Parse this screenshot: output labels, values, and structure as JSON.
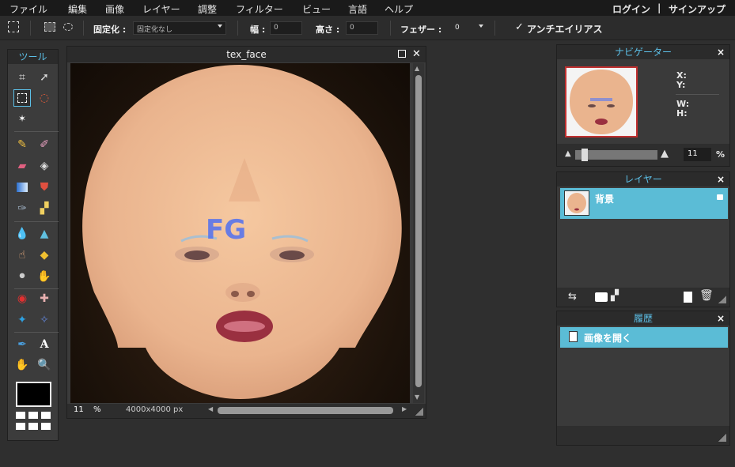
{
  "menu": [
    "ファイル",
    "編集",
    "画像",
    "レイヤー",
    "調整",
    "フィルター",
    "ビュー",
    "言語",
    "ヘルプ"
  ],
  "auth": {
    "login": "ログイン",
    "sep": "|",
    "signup": "サインアップ"
  },
  "options": {
    "fixed_label": "固定化 :",
    "fixed_value": "固定化なし",
    "width_label": "幅 :",
    "width_value": "0",
    "height_label": "高さ :",
    "height_value": "0",
    "feather_label": "フェザー :",
    "feather_value": "0",
    "antialias_label": "アンチエイリアス",
    "antialias_check": "✓"
  },
  "tools": {
    "title": "ツール"
  },
  "document": {
    "title": "tex_face",
    "zoom": "11",
    "zoom_unit": "%",
    "size": "4000x4000 px",
    "overlay_text": "FG"
  },
  "navigator": {
    "title": "ナビゲーター",
    "x_label": "X:",
    "y_label": "Y:",
    "w_label": "W:",
    "h_label": "H:",
    "zoom": "11",
    "zoom_unit": "%",
    "slider_level": 0.08
  },
  "layers": {
    "title": "レイヤー",
    "items": [
      {
        "name": "背景",
        "locked": true
      }
    ]
  },
  "history": {
    "title": "履歴",
    "items": [
      {
        "label": "画像を開く"
      }
    ]
  },
  "colors": {
    "accent": "#5cc0e8",
    "selected": "#5bbcd6",
    "foreground": "#000000"
  }
}
